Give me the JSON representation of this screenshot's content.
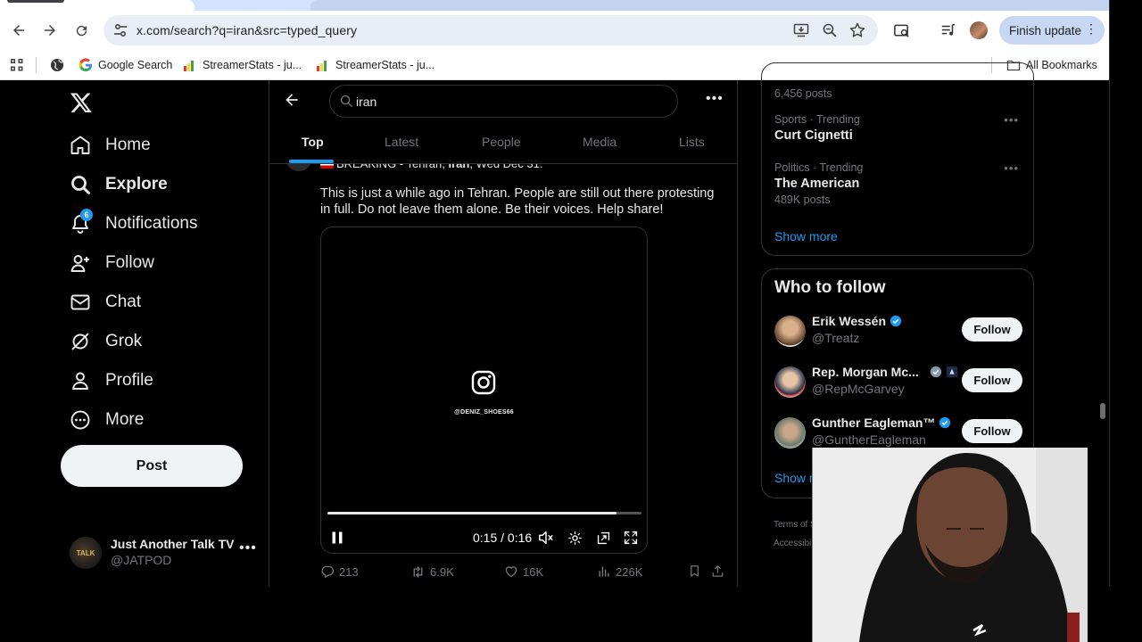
{
  "browser": {
    "url": "x.com/search?q=iran&src=typed_query",
    "finish_update_label": "Finish update",
    "bookmarks": [
      {
        "label": "Google Search"
      },
      {
        "label": "StreamerStats - ju..."
      },
      {
        "label": "StreamerStats - ju..."
      }
    ],
    "all_bookmarks_label": "All Bookmarks"
  },
  "nav": {
    "items": [
      {
        "label": "Home",
        "icon": "home-icon"
      },
      {
        "label": "Explore",
        "icon": "search-icon"
      },
      {
        "label": "Notifications",
        "icon": "bell-icon",
        "badge": "6"
      },
      {
        "label": "Follow",
        "icon": "add-person-icon"
      },
      {
        "label": "Chat",
        "icon": "envelope-icon"
      },
      {
        "label": "Grok",
        "icon": "grok-icon"
      },
      {
        "label": "Profile",
        "icon": "person-icon"
      },
      {
        "label": "More",
        "icon": "more-circle-icon"
      }
    ],
    "post_label": "Post",
    "account": {
      "name": "Just Another Talk TV",
      "handle": "@JATPOD",
      "pfp_text": "TALK"
    }
  },
  "search": {
    "query": "iran",
    "tabs": [
      {
        "label": "Top",
        "active": true
      },
      {
        "label": "Latest"
      },
      {
        "label": "People"
      },
      {
        "label": "Media"
      },
      {
        "label": "Lists"
      }
    ]
  },
  "tweet": {
    "top_line_prefix": "BREAKING - Tehran, ",
    "top_line_bold": "Iran",
    "top_line_suffix": ", Wed Dec 31:",
    "body": "This is just a while ago in Tehran. People are still out there protesting in full. Do not leave them alone. Be their voices. Help share!",
    "video": {
      "watermark": "@DENIZ_SHOES66",
      "time": "0:15 / 0:16",
      "progress": 0.92
    },
    "stats": {
      "replies": "213",
      "reposts": "6.9K",
      "likes": "16K",
      "views": "226K"
    }
  },
  "sidebar": {
    "trends": [
      {
        "category": "",
        "title": "",
        "count": "6,456 posts"
      },
      {
        "category": "Sports · Trending",
        "title": "Curt Cignetti",
        "count": ""
      },
      {
        "category": "Politics · Trending",
        "title": "The American",
        "count": "489K posts"
      }
    ],
    "show_more_label": "Show more",
    "who_to_follow": {
      "heading": "Who to follow",
      "users": [
        {
          "name": "Erik Wessén",
          "handle": "@Treatz",
          "follow_label": "Follow"
        },
        {
          "name": "Rep. Morgan Mc...",
          "handle": "@RepMcGarvey",
          "follow_label": "Follow"
        },
        {
          "name": "Gunther Eagleman™",
          "handle": "@GuntherEagleman",
          "follow_label": "Follow"
        }
      ],
      "show_more_label": "Show m"
    },
    "footer": [
      "Terms of S",
      "Accessibi"
    ]
  },
  "colors": {
    "accent": "#1d9bf0",
    "background": "#000000",
    "text": "#e7e9ea",
    "muted": "#71767b"
  }
}
